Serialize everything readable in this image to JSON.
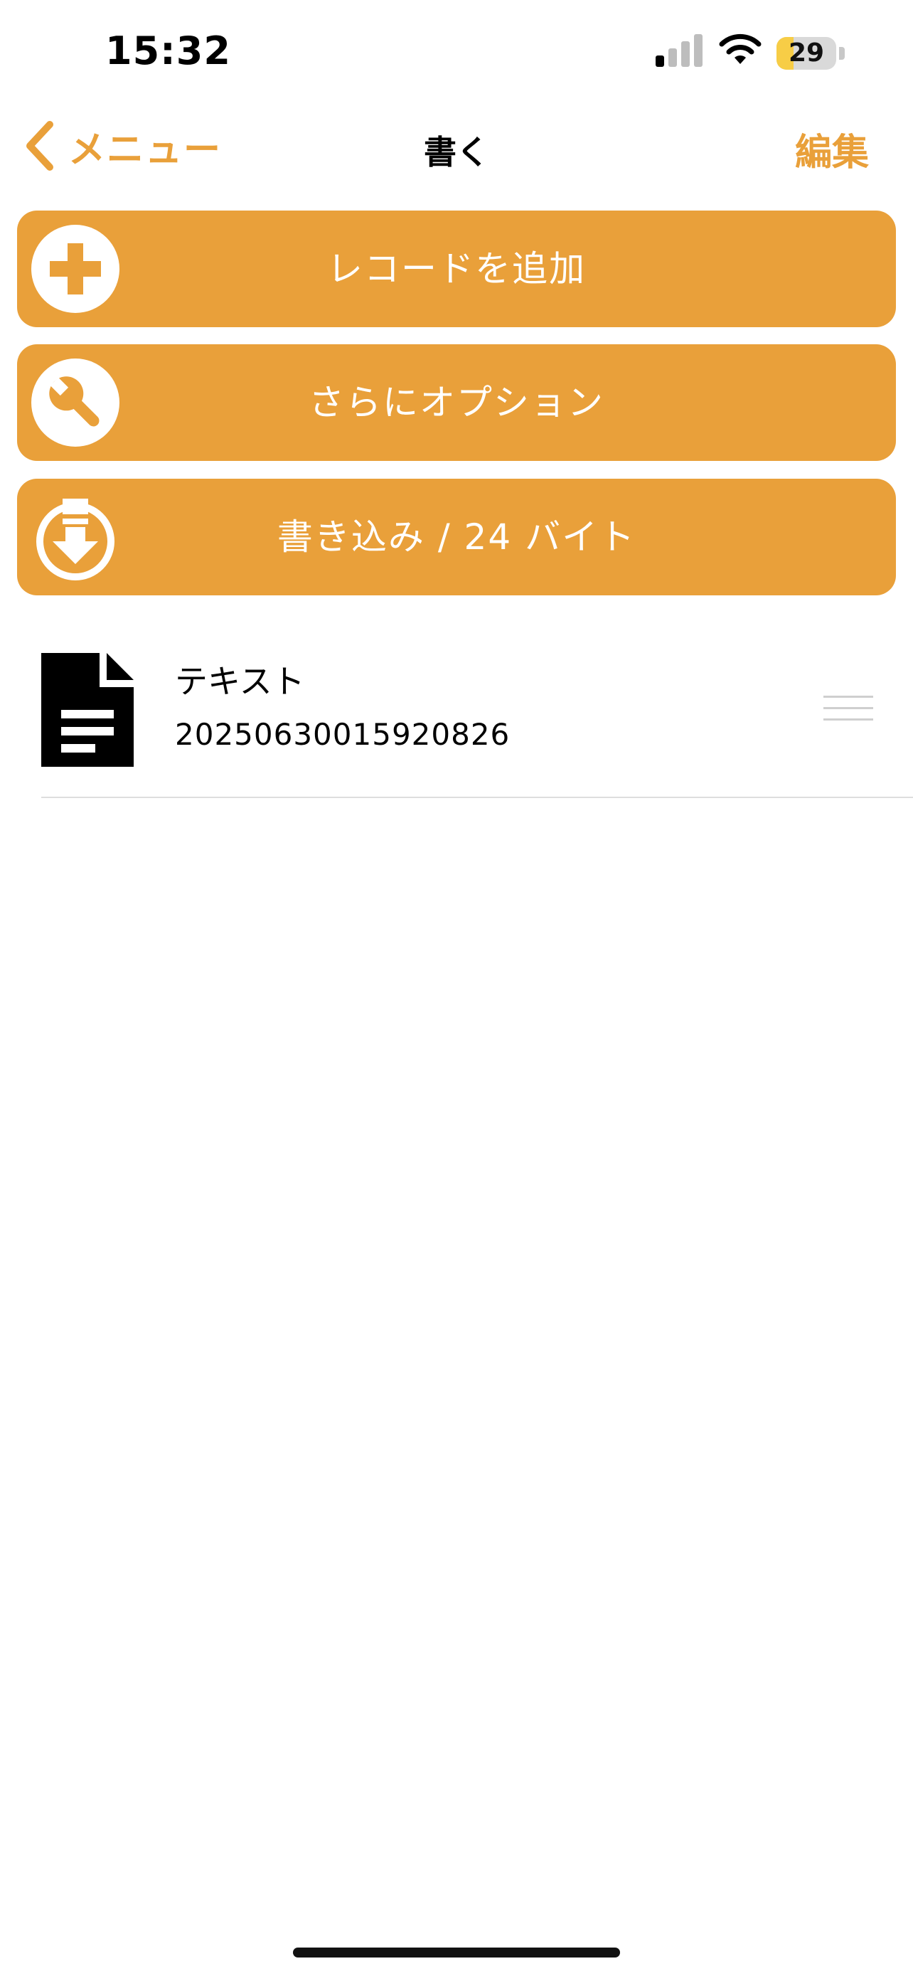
{
  "status_bar": {
    "time": "15:32",
    "battery_level": "29",
    "battery_fraction": 0.29,
    "icons": [
      "signal-icon",
      "wifi-icon",
      "battery-icon"
    ]
  },
  "nav": {
    "back_label": "メニュー",
    "title": "書く",
    "edit_label": "編集"
  },
  "actions": {
    "add_record": {
      "label": "レコードを追加",
      "icon": "plus-circle-icon"
    },
    "more_options": {
      "label": "さらにオプション",
      "icon": "wrench-circle-icon"
    },
    "write": {
      "label": "書き込み / 24 バイト",
      "icon": "download-circle-icon"
    }
  },
  "records": [
    {
      "type": "テキスト",
      "value": "20250630015920826",
      "icon": "document-text-icon"
    }
  ],
  "colors": {
    "accent": "#e9a03a",
    "battery": "#f7cd46"
  }
}
